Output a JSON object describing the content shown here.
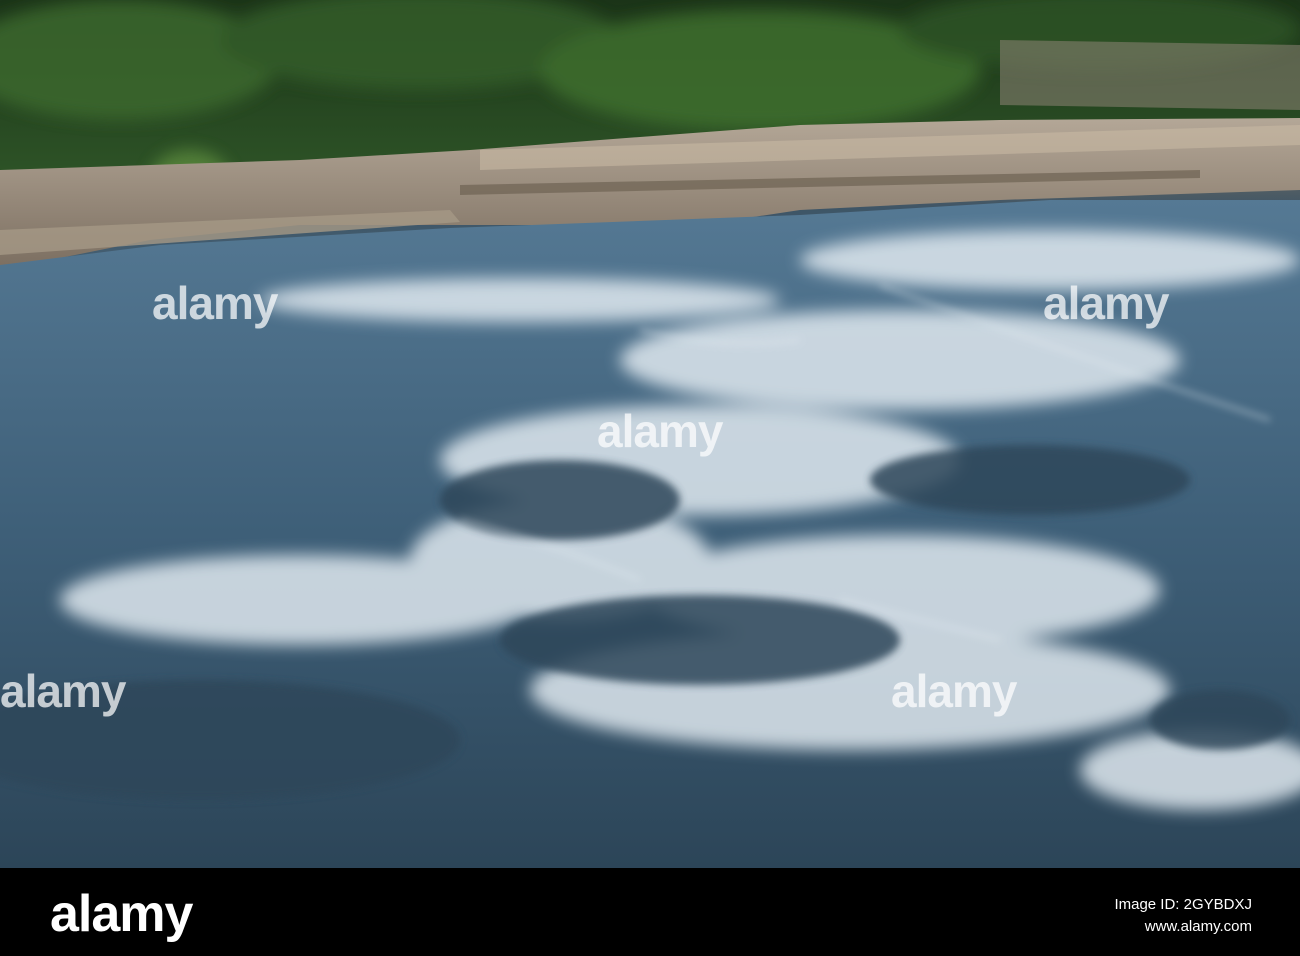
{
  "image": {
    "subject": "",
    "watermark_text": "alamy"
  },
  "footer": {
    "logo_text": "alamy",
    "image_id_label": "Image ID: 2GYBDXJ",
    "site_text": "www.alamy.com"
  }
}
